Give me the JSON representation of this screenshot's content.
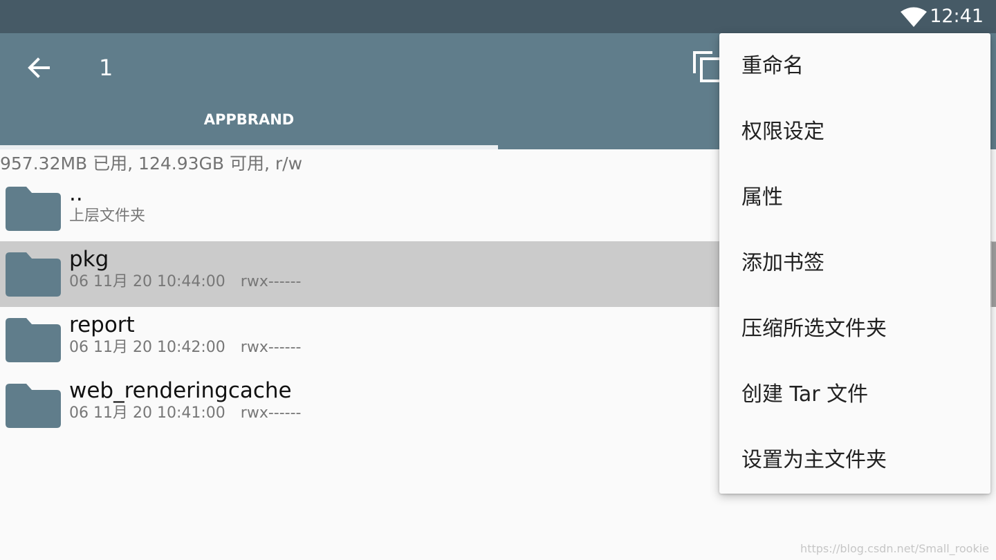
{
  "status_bar": {
    "time": "12:41",
    "wifi_icon": "wifi-icon"
  },
  "toolbar": {
    "back_icon": "arrow-left-icon",
    "title": "1",
    "copy_icon": "copy-icon",
    "tab_label": "APPBRAND"
  },
  "storage": {
    "info": "957.32MB 已用, 124.93GB 可用, r/w"
  },
  "files": [
    {
      "name": "..",
      "meta": "上层文件夹",
      "perm": "",
      "selected": false
    },
    {
      "name": "pkg",
      "meta": "06 11月 20 10:44:00",
      "perm": "rwx------",
      "selected": true
    },
    {
      "name": "report",
      "meta": "06 11月 20 10:42:00",
      "perm": "rwx------",
      "selected": false
    },
    {
      "name": "web_renderingcache",
      "meta": "06 11月 20 10:41:00",
      "perm": "rwx------",
      "selected": false
    }
  ],
  "menu": {
    "items": [
      {
        "label": "重命名"
      },
      {
        "label": "权限设定"
      },
      {
        "label": "属性"
      },
      {
        "label": "添加书签"
      },
      {
        "label": "压缩所选文件夹"
      },
      {
        "label": "创建 Tar 文件"
      },
      {
        "label": "设置为主文件夹"
      }
    ]
  },
  "watermark": "https://blog.csdn.net/Small_rookie",
  "colors": {
    "status_bar": "#465a66",
    "toolbar": "#607d8b",
    "folder": "#607d8b",
    "selected_row": "#cbcbcb"
  }
}
